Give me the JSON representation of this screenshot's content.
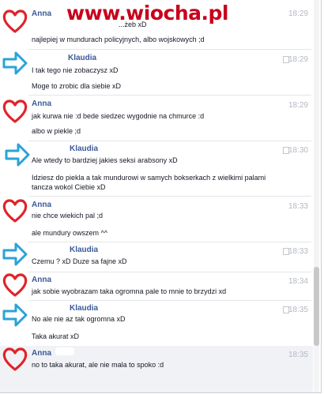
{
  "watermark": "www.wiocha.pl",
  "messages": [
    {
      "sender": "Anna",
      "time": "18:29",
      "lines": [
        "...żeb xD",
        "najlepiej w mundurach policyjnych, albo wojskowych ;d"
      ]
    },
    {
      "sender": "Klaudia",
      "time": "18:29",
      "lines": [
        "I tak tego nie zobaczysz xD",
        "Moge to zrobic dla siebie xD"
      ]
    },
    {
      "sender": "Anna",
      "time": "18:29",
      "lines": [
        "jak kurwa nie :d bede siedzec wygodnie na chmurce :d",
        "albo w piekle ;d"
      ]
    },
    {
      "sender": "Klaudia",
      "time": "18:30",
      "lines": [
        "Ale wtedy to bardziej jakies seksi arabsony xD",
        "Idziesz do piekla a tak mundurowi w samych bokserkach z wielkimi palami tancza wokol Ciebie xD"
      ]
    },
    {
      "sender": "Anna",
      "time": "18:33",
      "lines": [
        "nie chce wiekich pal ;d",
        "ale mundury owszem ^^"
      ]
    },
    {
      "sender": "Klaudia",
      "time": "18:33",
      "lines": [
        "Czemu ? xD Duze sa fajne xD"
      ]
    },
    {
      "sender": "Anna",
      "time": "18:34",
      "lines": [
        "jak sobie wyobrazam taka ogromna pale to mnie to brzydzi xd"
      ]
    },
    {
      "sender": "Klaudia",
      "time": "18:35",
      "lines": [
        "No ale nie az tak ogromna xD",
        "Taka akurat xD"
      ]
    },
    {
      "sender": "Anna",
      "time": "18:35",
      "lines": [
        "no to taka akurat, ale nie mala to spoko :d"
      ]
    }
  ],
  "icons": {
    "anna": "heart-icon",
    "klaudia": "arrow-right-icon"
  },
  "colors": {
    "sender_name": "#3b5998",
    "heart": "#e0232a",
    "arrow": "#2aa3d8",
    "timestamp": "#b4b8c2"
  }
}
